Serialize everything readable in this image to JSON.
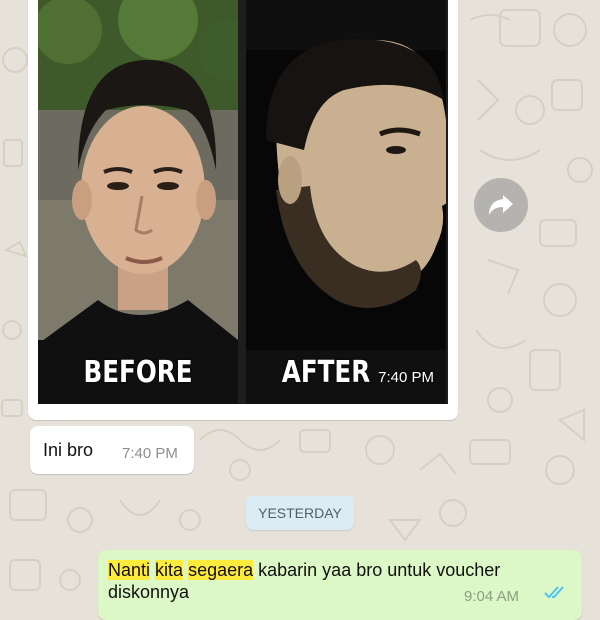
{
  "image_message": {
    "before_label": "BEFORE",
    "after_label": "AFTER",
    "time": "7:40 PM"
  },
  "text_message": {
    "text": "Ini bro",
    "time": "7:40 PM"
  },
  "date_separator": "YESTERDAY",
  "outgoing_message": {
    "highlight_1": "Nanti",
    "space_1": " ",
    "highlight_2": "kita",
    "space_2": " ",
    "highlight_3": "segaera",
    "rest": " kabarin yaa bro untuk voucher diskonnya",
    "time": "9:04 AM",
    "status": "read"
  },
  "icons": {
    "forward": "forward-arrow-icon",
    "read_receipt": "double-check-icon"
  },
  "colors": {
    "wallpaper": "#e7e2d9",
    "incoming_bubble": "#ffffff",
    "outgoing_bubble": "#dcf8c6",
    "date_chip": "#dcecf4",
    "search_highlight": "#ffeb3b",
    "read_ticks": "#4fc3f7"
  }
}
